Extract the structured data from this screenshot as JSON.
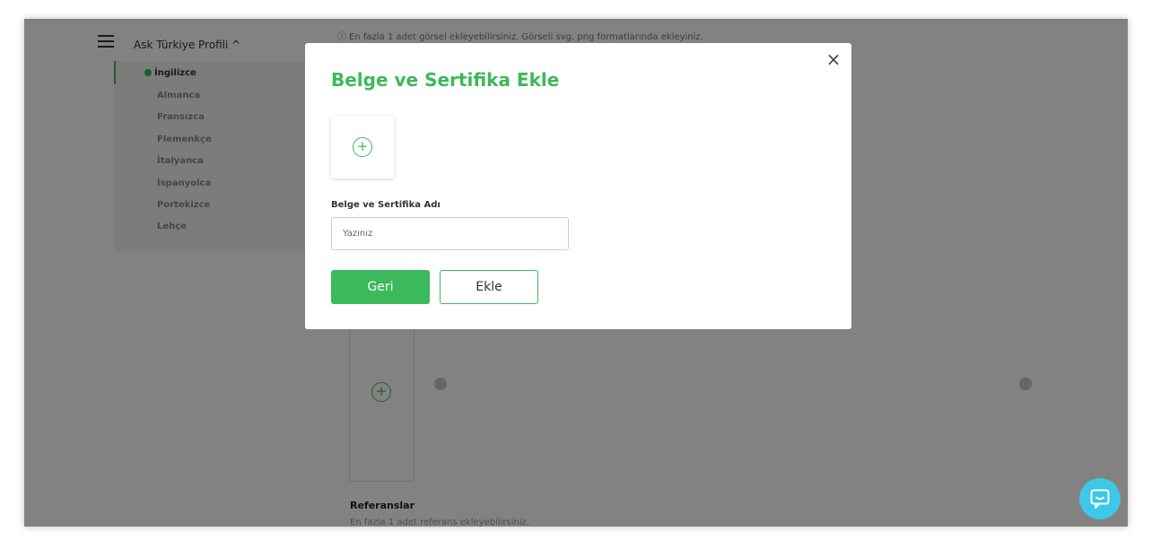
{
  "background": {
    "profile_title": "Ask Türkiye Profili ^",
    "info_text": "En fazla 1 adet görsel ekleyebilirsiniz. Görseli svg, png formatlarında ekleyiniz.",
    "sidebar_items": [
      "İngilizce",
      "Almanca",
      "Fransızca",
      "Flemenkçe",
      "İtalyanca",
      "İspanyolca",
      "Portekizce",
      "Lehçe"
    ],
    "references_label": "Referanslar",
    "references_sub": "En fazla 1 adet referans ekleyebilirsiniz."
  },
  "modal": {
    "title": "Belge ve Sertifika Ekle",
    "close_symbol": "×",
    "upload_symbol": "+",
    "field_label": "Belge ve Sertifika Adı",
    "field_placeholder": "Yazınız",
    "back_label": "Geri",
    "add_label": "Ekle"
  },
  "colors": {
    "accent": "#3cb95a",
    "chat": "#3cc8e6"
  }
}
